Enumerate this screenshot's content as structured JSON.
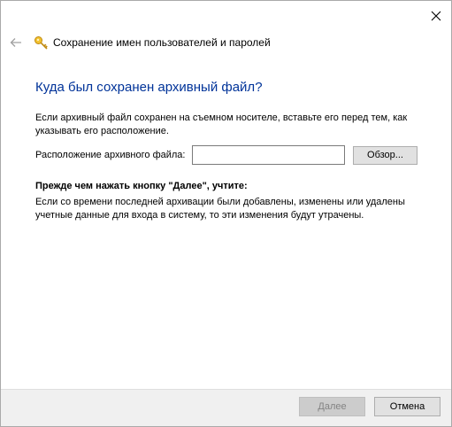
{
  "window": {
    "title": "Сохранение имен пользователей и паролей",
    "close_icon": "close-icon"
  },
  "header": {
    "back_icon": "back-arrow-icon",
    "key_icon": "key-icon"
  },
  "main": {
    "heading": "Куда был сохранен архивный файл?",
    "description": "Если архивный файл сохранен на съемном носителе, вставьте его перед тем, как указывать его расположение.",
    "location_label": "Расположение архивного файла:",
    "location_value": "",
    "browse_label": "Обзор...",
    "note_heading": "Прежде чем нажать кнопку \"Далее\", учтите:",
    "note_text": "Если со времени последней архивации были добавлены, изменены или удалены учетные данные для входа в систему, то эти изменения будут утрачены."
  },
  "footer": {
    "next_label": "Далее",
    "cancel_label": "Отмена"
  },
  "colors": {
    "heading": "#003399",
    "footer_bg": "#f0f0f0",
    "disabled_button": "#cccccc"
  }
}
